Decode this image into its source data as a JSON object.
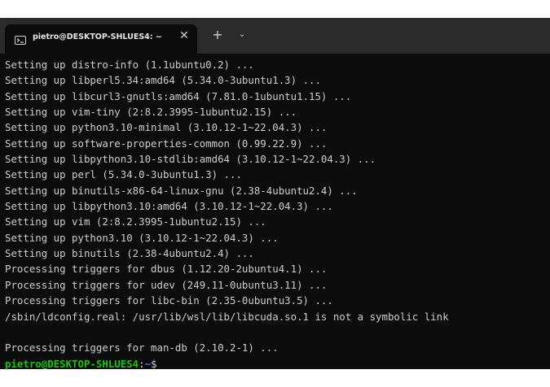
{
  "tab": {
    "icon": "terminal-icon",
    "title": "pietro@DESKTOP-SHLUES4: ~",
    "close_glyph": "✕"
  },
  "toolbar": {
    "new_tab_glyph": "+",
    "dropdown_glyph": "⌄"
  },
  "terminal": {
    "lines": [
      "Setting up distro-info (1.1ubuntu0.2) ...",
      "Setting up libperl5.34:amd64 (5.34.0-3ubuntu1.3) ...",
      "Setting up libcurl3-gnutls:amd64 (7.81.0-1ubuntu1.15) ...",
      "Setting up vim-tiny (2:8.2.3995-1ubuntu2.15) ...",
      "Setting up python3.10-minimal (3.10.12-1~22.04.3) ...",
      "Setting up software-properties-common (0.99.22.9) ...",
      "Setting up libpython3.10-stdlib:amd64 (3.10.12-1~22.04.3) ...",
      "Setting up perl (5.34.0-3ubuntu1.3) ...",
      "Setting up binutils-x86-64-linux-gnu (2.38-4ubuntu2.4) ...",
      "Setting up libpython3.10:amd64 (3.10.12-1~22.04.3) ...",
      "Setting up vim (2:8.2.3995-1ubuntu2.15) ...",
      "Setting up python3.10 (3.10.12-1~22.04.3) ...",
      "Setting up binutils (2.38-4ubuntu2.4) ...",
      "Processing triggers for dbus (1.12.20-2ubuntu4.1) ...",
      "Processing triggers for udev (249.11-0ubuntu3.11) ...",
      "Processing triggers for libc-bin (2.35-0ubuntu3.5) ...",
      "/sbin/ldconfig.real: /usr/lib/wsl/lib/libcuda.so.1 is not a symbolic link",
      "",
      "Processing triggers for man-db (2.10.2-1) ..."
    ],
    "prompt": {
      "user_host": "pietro@DESKTOP-SHLUES4",
      "separator": ":",
      "path": "~",
      "symbol": "$"
    }
  },
  "colors": {
    "background": "#0c0c0c",
    "titlebar": "#2b2b2b",
    "text": "#cccccc",
    "prompt_user": "#16c60c",
    "prompt_path": "#3b78ff"
  }
}
